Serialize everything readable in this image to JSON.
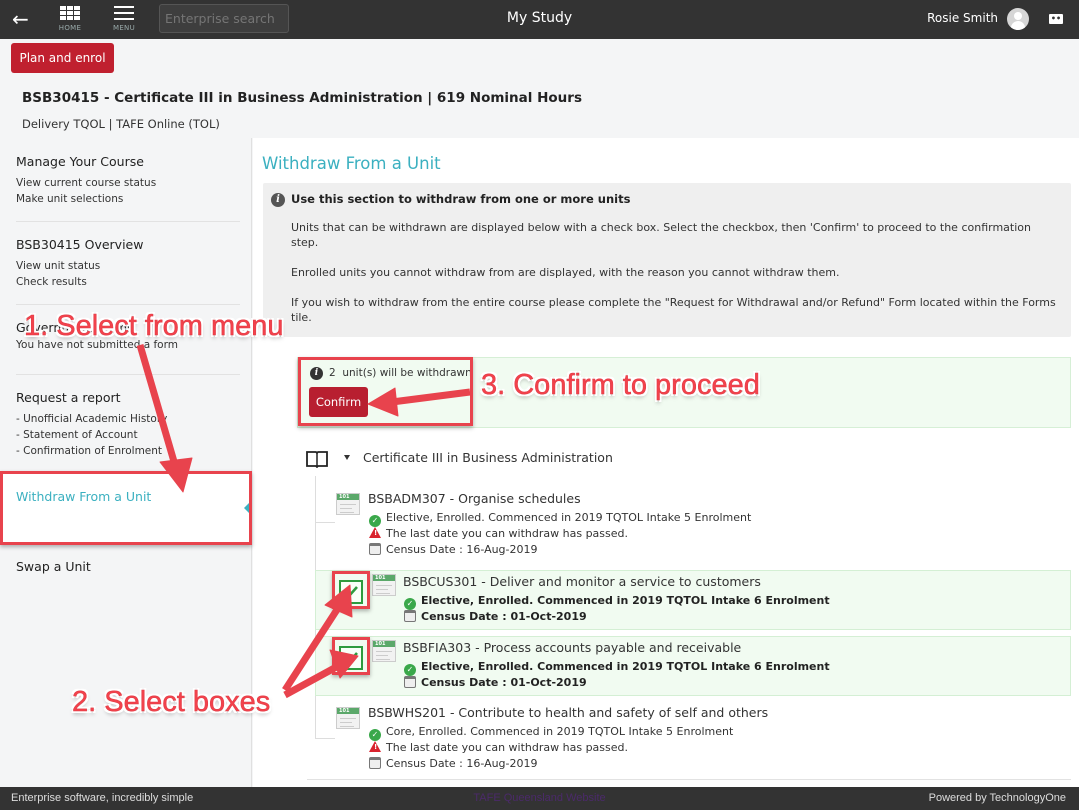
{
  "topbar": {
    "back_icon": "arrow-left-icon",
    "home_label": "HOME",
    "menu_label": "MENU",
    "search_placeholder": "Enterprise search",
    "app_title": "My Study",
    "user_name": "Rosie Smith",
    "avatar_icon": "user-avatar-icon",
    "context_icon": "context-switch-icon"
  },
  "header": {
    "plan_button": "Plan and enrol",
    "course_title": "BSB30415 - Certificate III in Business Administration | 619 Nominal Hours",
    "course_subtitle": "Delivery TQOL | TAFE Online (TOL)"
  },
  "sidebar": {
    "items": [
      {
        "title": "Manage Your Course",
        "links": [
          "View current course status",
          "Make unit selections"
        ]
      },
      {
        "title": "BSB30415 Overview",
        "links": [
          "View unit status",
          "Check results"
        ]
      },
      {
        "title": "Government forms",
        "links": [
          "You have not submitted a form"
        ]
      },
      {
        "title": "Request a report",
        "links": [
          "- Unofficial Academic History",
          "- Statement of Account",
          "- Confirmation of Enrolment"
        ]
      },
      {
        "title": "Withdraw From a Unit",
        "links": [],
        "active": true
      },
      {
        "title": "Swap a Unit",
        "links": []
      }
    ]
  },
  "main": {
    "page_title": "Withdraw From a Unit",
    "info": {
      "heading": "Use this section to withdraw from one or more units",
      "paragraphs": [
        "Units that can be withdrawn are displayed below with a check box. Select the checkbox, then 'Confirm' to proceed to the confirmation step.",
        "Enrolled units you cannot withdraw from are displayed, with the reason you cannot withdraw them.",
        "If you wish to withdraw from the entire course please complete the \"Request for Withdrawal and/or Refund\" Form located within the Forms tile."
      ]
    },
    "confirm_panel": {
      "count": "2",
      "message": "unit(s) will be withdrawn",
      "confirm_button": "Confirm"
    },
    "course_group": {
      "label": "Certificate III in Business Administration",
      "expanded": true
    },
    "units": [
      {
        "title": "BSBADM307 - Organise schedules",
        "status": "Elective, Enrolled. Commenced in 2019 TQTOL Intake 5 Enrolment",
        "warning": "The last date you can withdraw has passed.",
        "census": "Census Date : 16-Aug-2019",
        "selectable": false,
        "checked": false
      },
      {
        "title": "BSBCUS301 - Deliver and monitor a service to customers",
        "status": "Elective, Enrolled. Commenced in 2019 TQTOL Intake 6 Enrolment",
        "warning": "",
        "census": "Census Date : 01-Oct-2019",
        "selectable": true,
        "checked": true
      },
      {
        "title": "BSBFIA303 - Process accounts payable and receivable",
        "status": "Elective, Enrolled. Commenced in 2019 TQTOL Intake 6 Enrolment",
        "warning": "",
        "census": "Census Date : 01-Oct-2019",
        "selectable": true,
        "checked": true
      },
      {
        "title": "BSBWHS201 - Contribute to health and safety of self and others",
        "status": "Core, Enrolled. Commenced in 2019 TQTOL Intake 5 Enrolment",
        "warning": "The last date you can withdraw has passed.",
        "census": "Census Date : 16-Aug-2019",
        "selectable": false,
        "checked": false
      }
    ],
    "unit_icon_label": "101"
  },
  "annotations": {
    "step1": "1. Select from menu",
    "step2": "2. Select boxes",
    "step3": "3. Confirm to proceed",
    "color": "#e8434d"
  },
  "footer": {
    "left": "Enterprise software, incredibly simple",
    "center_link": "TAFE Queensland Website",
    "right": "Powered by TechnologyOne"
  },
  "colors": {
    "topbar": "#333333",
    "accent": "#3bb0c0",
    "primary_button": "#c0202f",
    "selected_row": "#f1fbf1",
    "success": "#3aa84a",
    "warning": "#d9232e"
  }
}
